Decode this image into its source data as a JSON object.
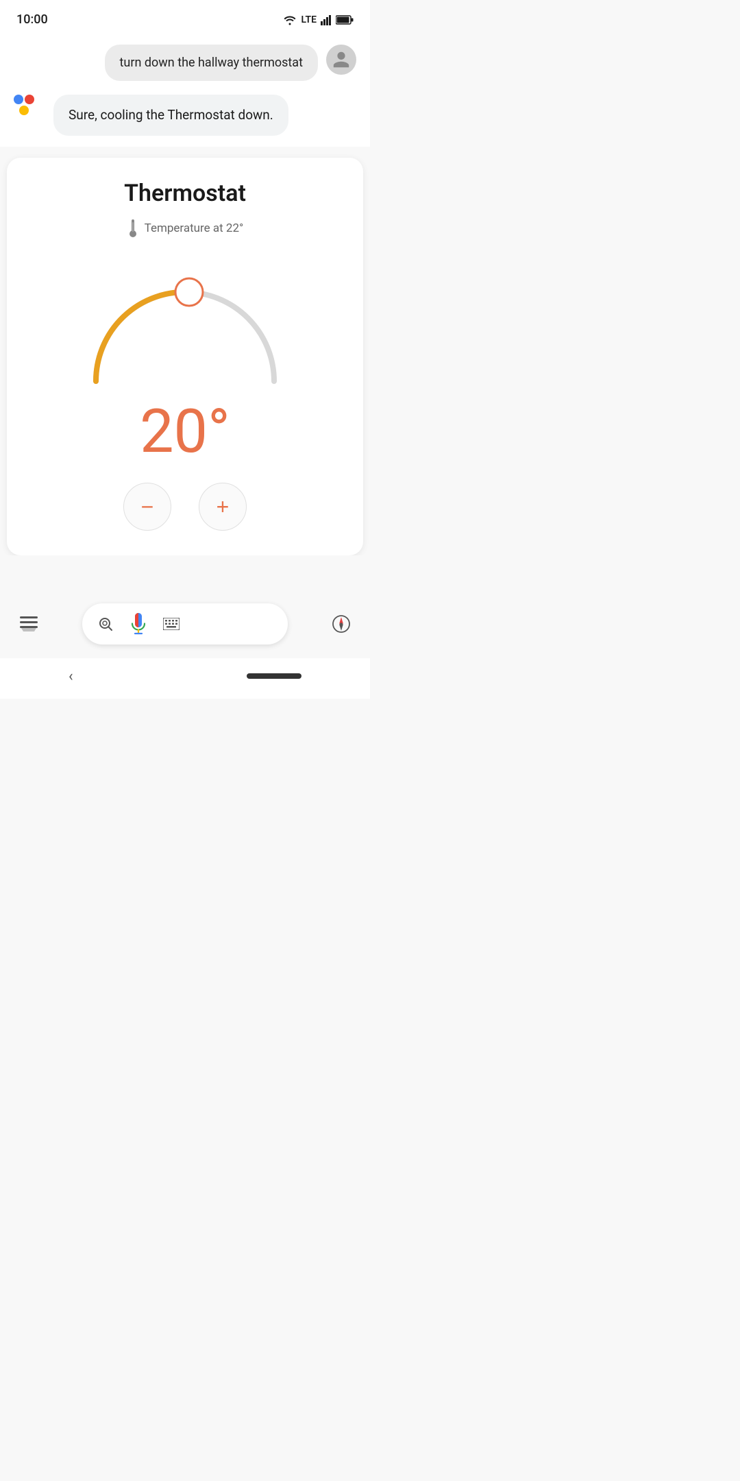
{
  "statusBar": {
    "time": "10:00",
    "wifi": "▼",
    "lte": "LTE",
    "battery": "🔋"
  },
  "userMessage": {
    "text": "turn down the hallway thermostat"
  },
  "assistantMessage": {
    "text": "Sure, cooling the Thermostat down."
  },
  "thermostat": {
    "title": "Thermostat",
    "tempLabel": "Temperature at 22°",
    "currentTemp": "20°",
    "decreaseLabel": "−",
    "increaseLabel": "+"
  },
  "bottomBar": {
    "lensLabel": "lens",
    "keyboardLabel": "keyboard",
    "compassLabel": "compass",
    "menuLabel": "menu"
  }
}
